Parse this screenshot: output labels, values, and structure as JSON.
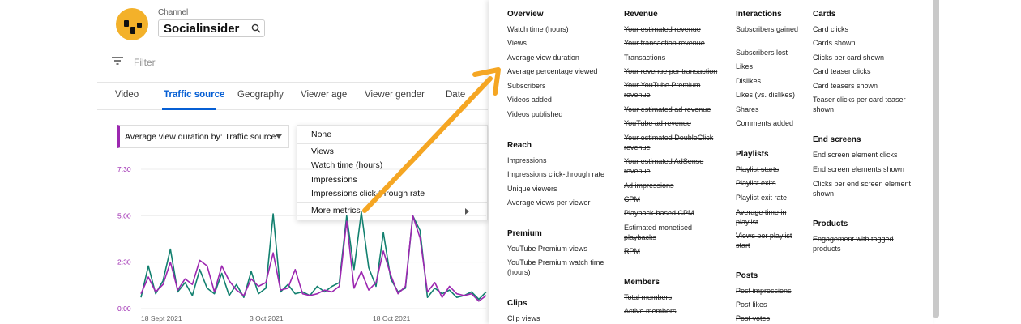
{
  "channel": {
    "label": "Channel",
    "name": "Socialinsider"
  },
  "filter": {
    "label": "Filter"
  },
  "tabs": [
    "Video",
    "Traffic source",
    "Geography",
    "Viewer age",
    "Viewer gender",
    "Date"
  ],
  "active_tab": "Traffic source",
  "metric_select": {
    "label": "Average view duration by: Traffic source"
  },
  "metric_menu": {
    "items": [
      "None",
      "Views",
      "Watch time (hours)",
      "Impressions",
      "Impressions click-through rate",
      "More metrics"
    ]
  },
  "colors": {
    "accent_blue": "#065fd4",
    "series_purple": "#9c27b0",
    "series_teal": "#12806f",
    "arrow": "#f5a623"
  },
  "chart_data": {
    "type": "line",
    "y_ticks": [
      "7:30",
      "5:00",
      "2:30",
      "0:00"
    ],
    "x_ticks": [
      "18 Sept 2021",
      "3 Oct 2021",
      "18 Oct 2021"
    ],
    "ylim": [
      0,
      7.5
    ],
    "series": [
      {
        "values": [
          0.6,
          2.3,
          0.8,
          1.5,
          3.2,
          0.9,
          1.4,
          0.7,
          2.1,
          1.1,
          0.8,
          1.9,
          0.7,
          1.3,
          0.6,
          2.0,
          0.8,
          1.1,
          5.1,
          0.9,
          1.3,
          0.8,
          0.9,
          0.7,
          1.2,
          0.9,
          1.2,
          1.4,
          5.0,
          2.1,
          5.2,
          2.2,
          1.2,
          4.1,
          1.6,
          0.9,
          1.1,
          5.0,
          4.2,
          0.6,
          1.1,
          0.8,
          1.0,
          0.6,
          0.7,
          0.9,
          0.5,
          0.9
        ]
      },
      {
        "values": [
          0.8,
          1.7,
          0.9,
          1.3,
          2.5,
          1.0,
          1.6,
          1.3,
          2.6,
          2.3,
          0.9,
          2.3,
          1.5,
          1.0,
          0.7,
          1.6,
          1.2,
          1.4,
          3.0,
          1.0,
          1.1,
          2.1,
          0.8,
          0.7,
          0.8,
          1.0,
          0.9,
          1.2,
          4.7,
          1.1,
          2.0,
          1.0,
          1.4,
          3.1,
          1.8,
          0.8,
          1.2,
          5.0,
          3.8,
          0.9,
          1.4,
          0.6,
          1.2,
          0.8,
          0.7,
          0.8,
          0.4,
          0.7
        ]
      }
    ]
  },
  "panel": {
    "overview": {
      "title": "Overview",
      "items": [
        "Watch time (hours)",
        "Views",
        "Average view duration",
        "Average percentage viewed",
        "Subscribers",
        "Videos added",
        "Videos published"
      ]
    },
    "reach": {
      "title": "Reach",
      "items": [
        "Impressions",
        "Impressions click-through rate",
        "Unique viewers",
        "Average views per viewer"
      ]
    },
    "premium": {
      "title": "Premium",
      "items": [
        "YouTube Premium views",
        "YouTube Premium watch time (hours)"
      ]
    },
    "clips": {
      "title": "Clips",
      "items": [
        "Clip views"
      ]
    },
    "revenue": {
      "title": "Revenue",
      "items": [
        "Your estimated revenue",
        "Your transaction revenue",
        "Transactions",
        "Your revenue per transaction",
        "Your YouTube Premium revenue",
        "Your estimated ad revenue",
        "YouTube ad revenue",
        "Your estimated DoubleClick revenue",
        "Your estimated AdSense revenue",
        "Ad impressions",
        "CPM",
        "Playback-based CPM",
        "Estimated monetised playbacks",
        "RPM"
      ]
    },
    "members": {
      "title": "Members",
      "items": [
        "Total members",
        "Active members"
      ]
    },
    "interactions": {
      "title": "Interactions",
      "items": [
        "Subscribers gained",
        "Subscribers lost",
        "Likes",
        "Dislikes",
        "Likes (vs. dislikes)",
        "Shares",
        "Comments added"
      ]
    },
    "playlists": {
      "title": "Playlists",
      "items": [
        "Playlist starts",
        "Playlist exits",
        "Playlist exit rate",
        "Average time in playlist",
        "Views per playlist start"
      ]
    },
    "posts": {
      "title": "Posts",
      "items": [
        "Post impressions",
        "Post likes",
        "Post votes"
      ]
    },
    "cards": {
      "title": "Cards",
      "items": [
        "Card clicks",
        "Cards shown",
        "Clicks per card shown",
        "Card teaser clicks",
        "Card teasers shown",
        "Teaser clicks per card teaser shown"
      ]
    },
    "end_screens": {
      "title": "End screens",
      "items": [
        "End screen element clicks",
        "End screen elements shown",
        "Clicks per end screen element shown"
      ]
    },
    "products": {
      "title": "Products",
      "items": [
        "Engagement with tagged products"
      ]
    }
  }
}
